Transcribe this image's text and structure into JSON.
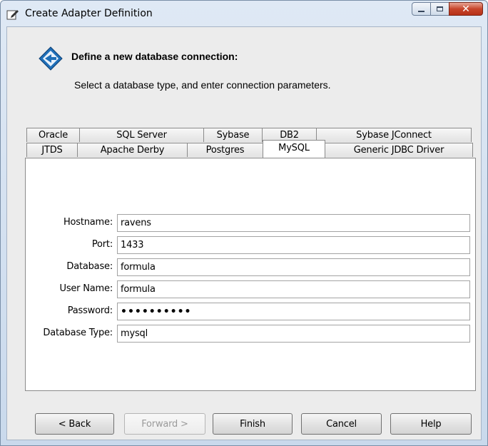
{
  "window": {
    "title": "Create Adapter Definition",
    "icon": "edit-document-icon",
    "controls": {
      "minimize": "minimize-icon",
      "maximize": "maximize-icon",
      "close": "✕"
    }
  },
  "header": {
    "icon": "diamond-arrow-icon",
    "title": "Define a new database connection:",
    "subtitle": "Select a database type, and enter connection parameters."
  },
  "tabs": {
    "row_top": [
      "Oracle",
      "SQL Server",
      "Sybase",
      "DB2",
      "Sybase JConnect"
    ],
    "row_bottom": [
      "JTDS",
      "Apache Derby",
      "Postgres",
      "MySQL",
      "Generic JDBC Driver"
    ],
    "selected": "MySQL"
  },
  "form": {
    "hostname": {
      "label": "Hostname:",
      "value": "ravens"
    },
    "port": {
      "label": "Port:",
      "value": "1433"
    },
    "database": {
      "label": "Database:",
      "value": "formula"
    },
    "username": {
      "label": "User Name:",
      "value": "formula"
    },
    "password": {
      "label": "Password:",
      "value": "••••••••••"
    },
    "dbtype": {
      "label": "Database Type:",
      "value": "mysql"
    }
  },
  "buttons": {
    "back": "< Back",
    "forward": "Forward >",
    "finish": "Finish",
    "cancel": "Cancel",
    "help": "Help"
  },
  "colors": {
    "close_button": "#c7452b",
    "dialog_bg": "#ececec",
    "icon_blue": "#1f6fb8"
  }
}
